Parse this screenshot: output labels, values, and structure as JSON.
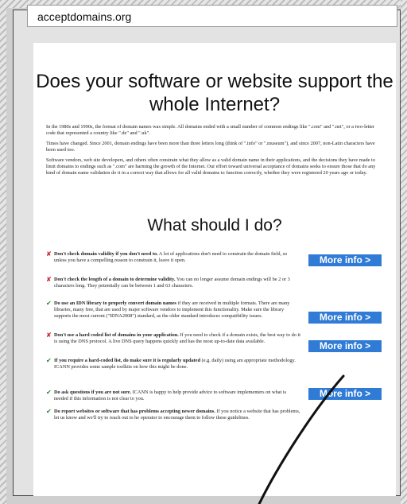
{
  "browser": {
    "url": "acceptdomains.org"
  },
  "page": {
    "title": "Does your software or website support the whole Internet?",
    "intro": [
      "In the 1980s and 1990s, the format of domain names was simple. All domains ended with a small number of common endings like \".com\" and \".net\", or a two-letter code that represented a country like \".de\" and \".uk\".",
      "Times have changed. Since 2001, domain endings have been more than three letters long (think of \".info\" or \".museum\"), and since 2007, non-Latin characters have been used too.",
      "Software vendors, web site developers, and others often constrain what they allow as a valid domain name in their applications, and the decisions they have made to limit domains to endings such as \".com\" are harming the growth of the Internet. Our effort toward universal acceptance of domains seeks to ensure those that do any kind of domain name validation do it in a correct way that allows for all valid domains to function correctly, whether they were registered 20 years ago or today."
    ],
    "subtitle": "What should I do?",
    "items": [
      {
        "status": "no",
        "bold": "Don't check domain validity if you don't need to.",
        "text": " A lot of applications don't need to constrain the domain field, so unless you have a compelling reason to constrain it, leave it open."
      },
      {
        "status": "no",
        "bold": "Don't check the length of a domain to determine validity.",
        "text": " You can no longer assume domain endings will be 2 or 3 characters long. They potentially can be between 1 and 63 characters."
      },
      {
        "status": "yes",
        "bold": "Do use an IDN library to properly convert domain names",
        "text": " if they are received in multiple formats. There are many libraries, many free, that are used by major software vendors to implement this functionality. Make sure the library supports the most current (\"IDNA2008\") standard, as the older standard introduces compatibility issues."
      },
      {
        "status": "no",
        "bold": "Don't use a hard coded list of domains in your application.",
        "text": " If you need to check if a domain exists, the best way to do it is using the DNS protocol. A live DNS query happens quickly and has the most up-to-date data available."
      },
      {
        "status": "yes",
        "bold": "If you require a hard-coded list, do make sure it is regularly updated",
        "text": " (e.g. daily) using am appropriate methodology. ICANN provides some sample toolkits on how this might be done."
      },
      {
        "status": "yes",
        "bold": "Do ask questions if you are not sure.",
        "text": " ICANN is happy to help provide advice to software implementers on what is needed if this information is not clear to you."
      },
      {
        "status": "yes",
        "bold": "Do report websites or software that has problems accepting newer domains.",
        "text": " If you notice a website that has problems, let us know and we'll try to reach out to he operator to encourage them to follow these guidelines."
      }
    ],
    "more_info_label": "More info >",
    "icons": {
      "no": "cross-icon",
      "yes": "check-icon"
    },
    "colors": {
      "accent": "#2f7bd6",
      "no": "#cc1f1f",
      "yes": "#1f8c2a"
    }
  }
}
